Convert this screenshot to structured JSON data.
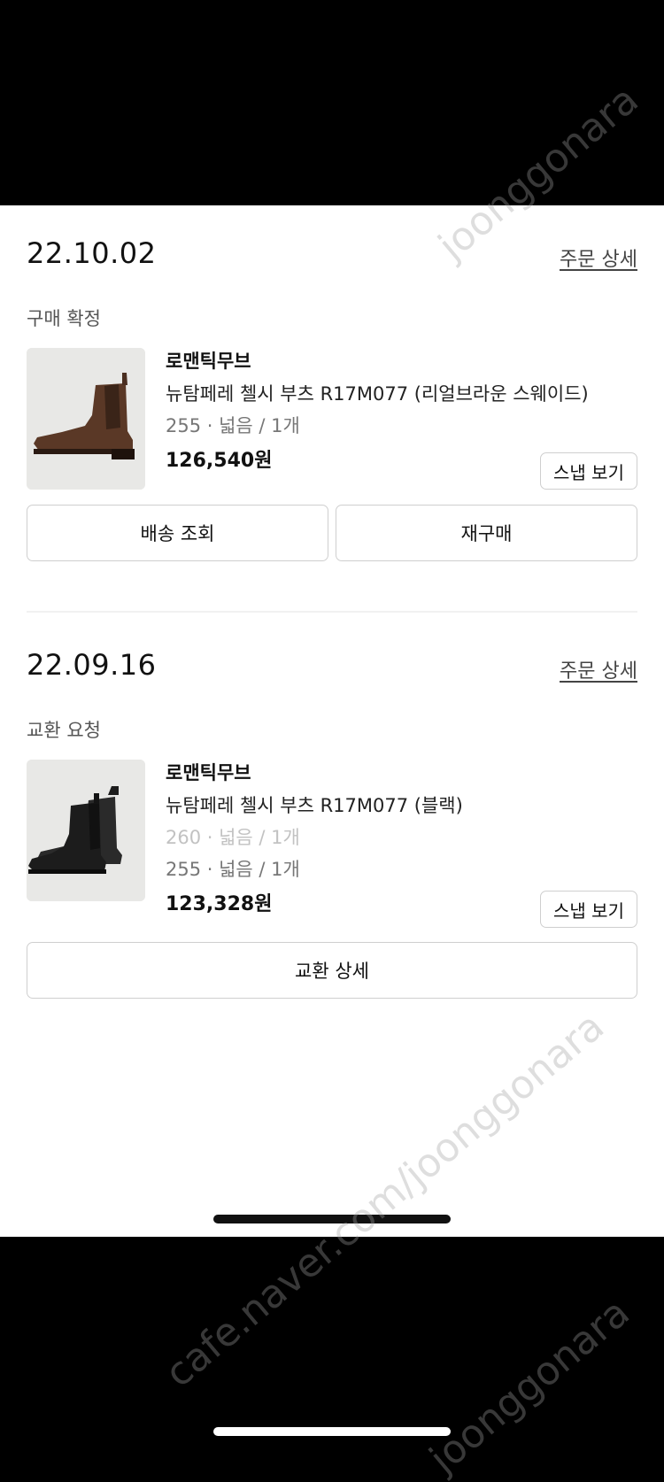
{
  "orders": [
    {
      "date": "22.10.02",
      "detail_link": "주문 상세",
      "status": "구매 확정",
      "brand": "로맨틱무브",
      "product_name": "뉴탐페레 첼시 부츠 R17M077 (리얼브라운 스웨이드)",
      "option": "255 · 넓음 / 1개",
      "price": "126,540원",
      "snap_button": "스냅 보기",
      "actions": [
        "배송 조회",
        "재구매"
      ]
    },
    {
      "date": "22.09.16",
      "detail_link": "주문 상세",
      "status": "교환 요청",
      "brand": "로맨틱무브",
      "product_name": "뉴탐페레 첼시 부츠 R17M077 (블랙)",
      "old_option": "260 · 넓음 / 1개",
      "option": "255 · 넓음 / 1개",
      "price": "123,328원",
      "snap_button": "스냅 보기",
      "actions": [
        "교환 상세"
      ]
    }
  ],
  "watermarks": [
    "cafe.naver.com/joonggonara",
    "cafe.naver.com/joonggonara",
    "joonggonara"
  ],
  "colors": {
    "background": "#000000",
    "sheet": "#ffffff",
    "thumb_bg": "#e8e8e6",
    "brown_boot": "#5a3826",
    "black_boot": "#1c1c1c"
  }
}
